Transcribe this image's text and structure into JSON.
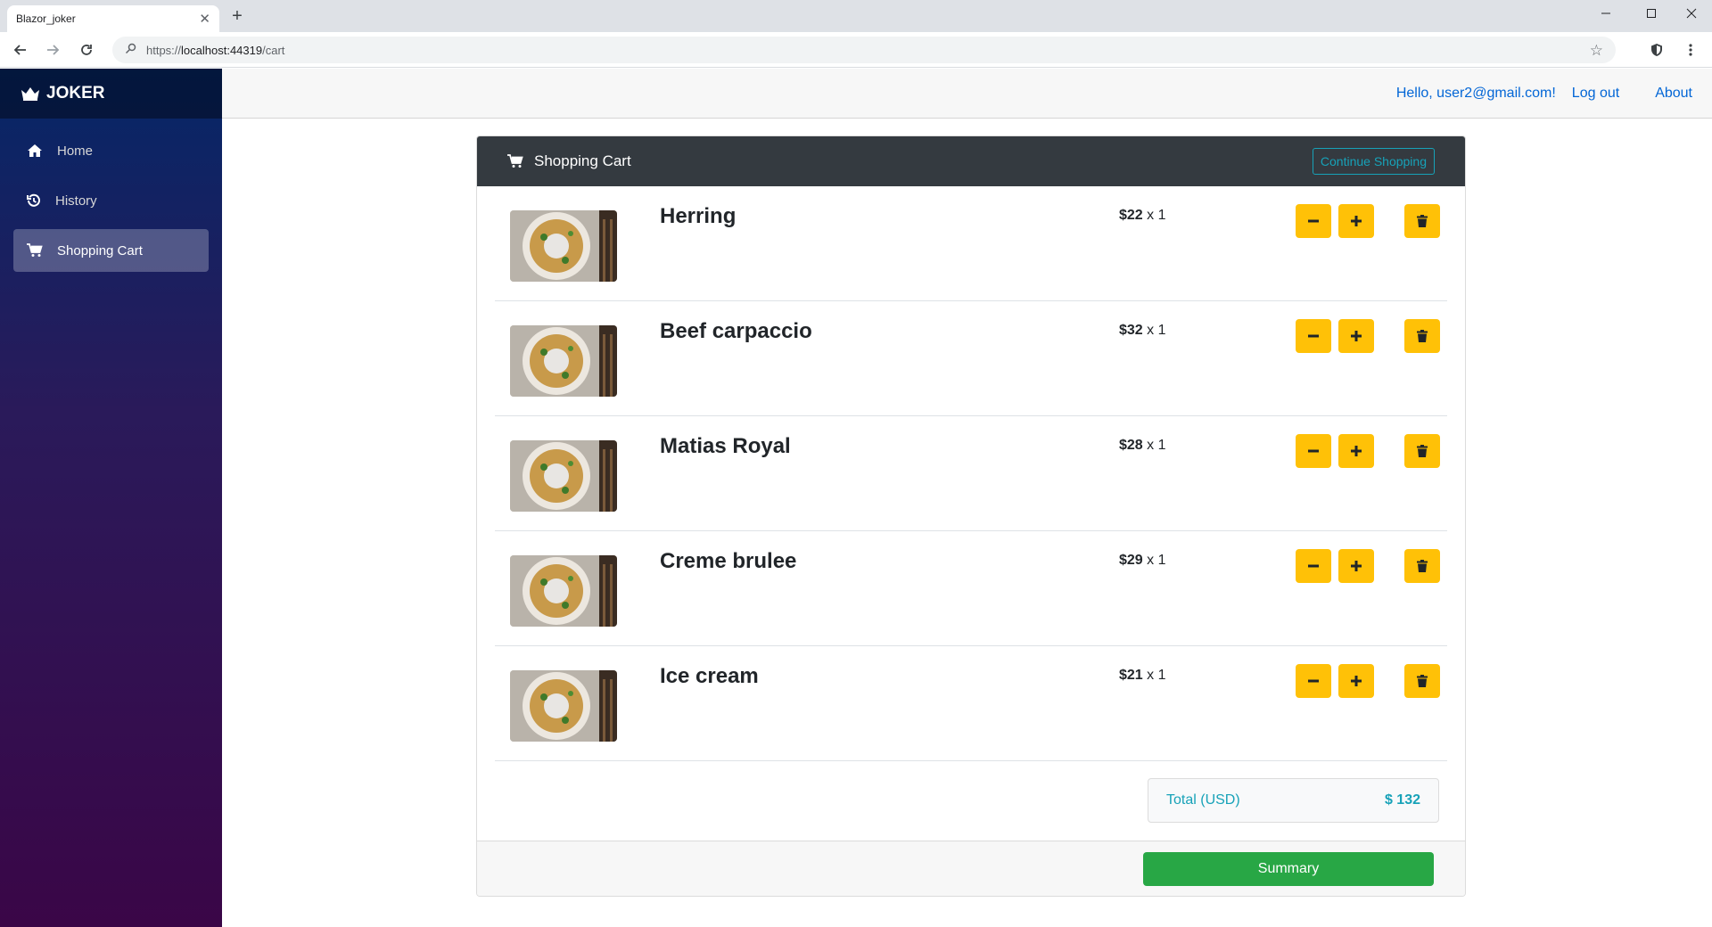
{
  "browser": {
    "tab_title": "Blazor_joker",
    "url_prefix": "https://",
    "url_host": "localhost:44319",
    "url_path": "/cart"
  },
  "sidebar": {
    "brand": "JOKER",
    "items": [
      {
        "label": "Home",
        "icon": "home-icon"
      },
      {
        "label": "History",
        "icon": "history-icon"
      },
      {
        "label": "Shopping Cart",
        "icon": "cart-icon",
        "active": true
      }
    ]
  },
  "header": {
    "greeting": "Hello, user2@gmail.com!",
    "logout": "Log out",
    "about": "About"
  },
  "cart": {
    "title": "Shopping Cart",
    "continue_label": "Continue Shopping",
    "items": [
      {
        "name": "Herring",
        "price": "$22",
        "qty": "x 1"
      },
      {
        "name": "Beef carpaccio",
        "price": "$32",
        "qty": "x 1"
      },
      {
        "name": "Matias Royal",
        "price": "$28",
        "qty": "x 1"
      },
      {
        "name": "Creme brulee",
        "price": "$29",
        "qty": "x 1"
      },
      {
        "name": "Ice cream",
        "price": "$21",
        "qty": "x 1"
      }
    ],
    "total_label": "Total (USD)",
    "total_value": "$ 132",
    "summary_label": "Summary"
  },
  "colors": {
    "accent_yellow": "#ffc107",
    "header_dark": "#343a40",
    "summary_green": "#28a745",
    "total_teal": "#17a2b8",
    "link_blue": "#0366d6"
  }
}
